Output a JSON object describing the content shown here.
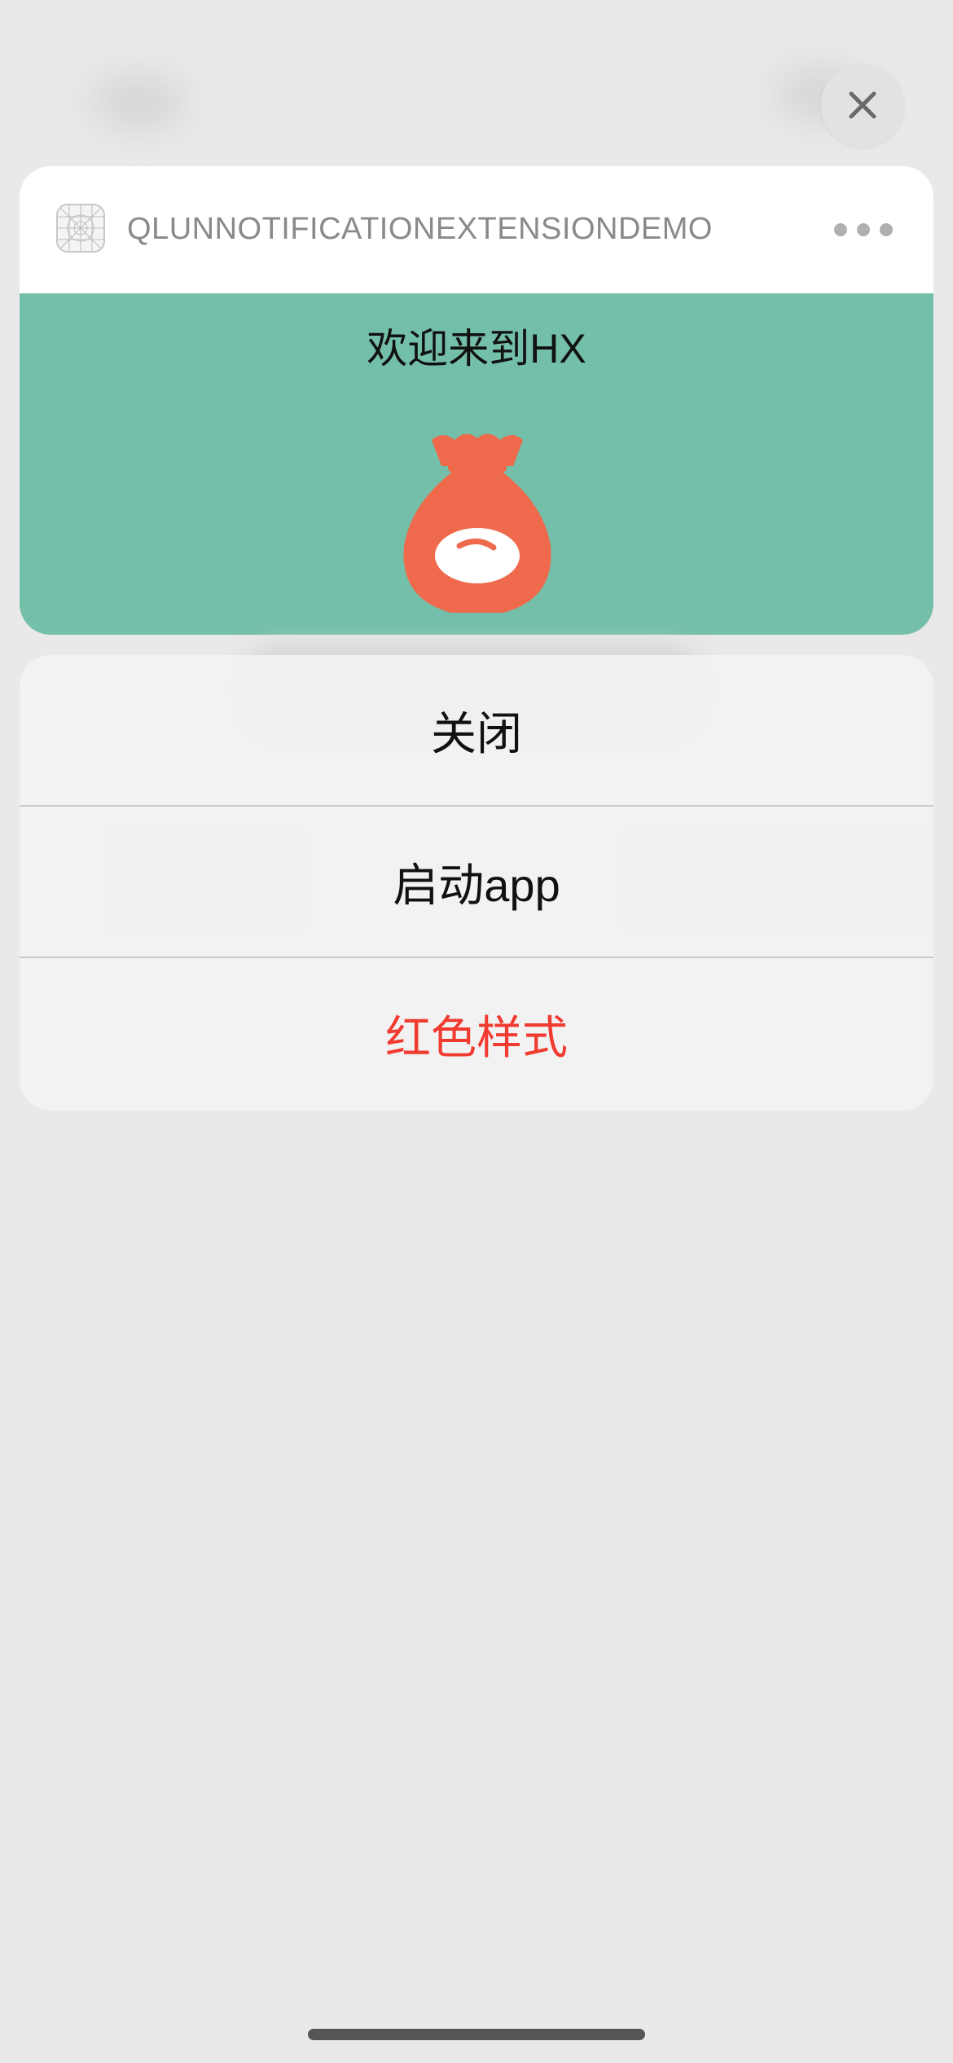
{
  "close_button": {
    "icon": "close-icon"
  },
  "notification": {
    "app_name": "QLUNNOTIFICATIONEXTENSIONDEMO",
    "app_icon": "app-placeholder-icon",
    "more_icon": "more-dots-icon",
    "content": {
      "welcome_text": "欢迎来到HX",
      "image": "money-bag-icon"
    }
  },
  "actions": [
    {
      "label": "关闭",
      "style": "default"
    },
    {
      "label": "启动app",
      "style": "default"
    },
    {
      "label": "红色样式",
      "style": "destructive"
    }
  ],
  "colors": {
    "content_background": "#74bfa9",
    "bag_color": "#ef6a4c",
    "destructive": "#f03b30"
  }
}
